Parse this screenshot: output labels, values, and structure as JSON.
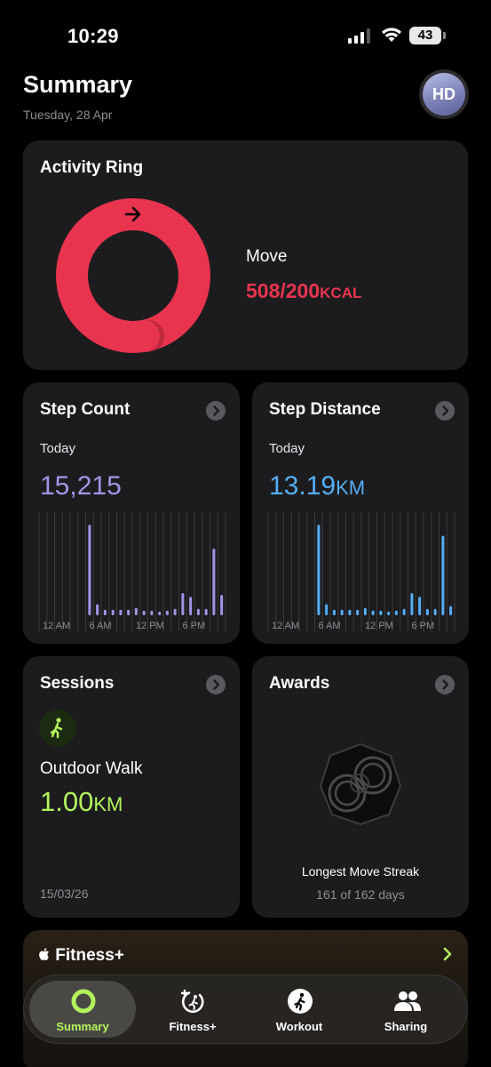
{
  "status_bar": {
    "time": "10:29",
    "battery": "43"
  },
  "header": {
    "title": "Summary",
    "date": "Tuesday, 28 Apr",
    "avatar_initials": "HD"
  },
  "activity_ring": {
    "title": "Activity Ring",
    "move_label": "Move",
    "move_value": "508/200",
    "move_unit": "KCAL",
    "move_progress": 2.54,
    "ring_color": "#e8344f"
  },
  "step_count": {
    "title": "Step Count",
    "period": "Today",
    "value": "15,215",
    "color": "#a493e6",
    "axis_labels": [
      "12 AM",
      "6 AM",
      "12 PM",
      "6 PM"
    ],
    "hourly_relative": [
      0,
      0,
      0,
      0,
      0,
      0,
      0.98,
      0.12,
      0.06,
      0.06,
      0.06,
      0.06,
      0.08,
      0.05,
      0.05,
      0.04,
      0.05,
      0.07,
      0.24,
      0.2,
      0.07,
      0.07,
      0.72,
      0.22
    ]
  },
  "step_distance": {
    "title": "Step Distance",
    "period": "Today",
    "value": "13.19",
    "unit": "KM",
    "color": "#56aef4",
    "axis_labels": [
      "12 AM",
      "6 AM",
      "12 PM",
      "6 PM"
    ],
    "hourly_relative": [
      0,
      0,
      0,
      0,
      0,
      0,
      0.98,
      0.12,
      0.06,
      0.06,
      0.06,
      0.06,
      0.08,
      0.05,
      0.05,
      0.04,
      0.05,
      0.07,
      0.24,
      0.2,
      0.07,
      0.07,
      0.86,
      0.1
    ]
  },
  "sessions": {
    "title": "Sessions",
    "activity": "Outdoor Walk",
    "value": "1.00",
    "unit": "KM",
    "date": "15/03/26",
    "icon": "figure-walk-icon",
    "accent": "#b3f35c"
  },
  "awards": {
    "title": "Awards",
    "name": "Longest Move Streak",
    "detail": "161 of 162 days",
    "icon": "award-badge-icon"
  },
  "fitness_plus": {
    "title": "Fitness+"
  },
  "tabbar": {
    "tabs": [
      {
        "label": "Summary",
        "icon": "activity-ring-icon",
        "active": true
      },
      {
        "label": "Fitness+",
        "icon": "fitness-plus-icon",
        "active": false
      },
      {
        "label": "Workout",
        "icon": "running-figure-icon",
        "active": false
      },
      {
        "label": "Sharing",
        "icon": "people-icon",
        "active": false
      }
    ]
  }
}
